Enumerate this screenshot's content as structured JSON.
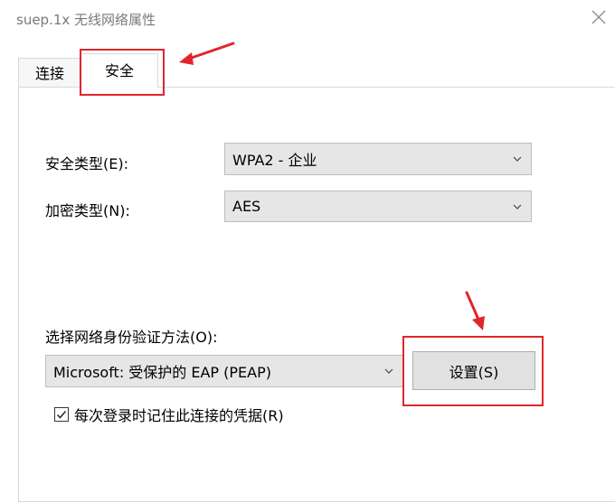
{
  "window": {
    "title": "suep.1x 无线网络属性",
    "close_icon": "close-icon"
  },
  "tabs": [
    {
      "label": "连接",
      "active": false
    },
    {
      "label": "安全",
      "active": true
    }
  ],
  "security": {
    "security_type_label": "安全类型(E):",
    "security_type_value": "WPA2 - 企业",
    "encryption_type_label": "加密类型(N):",
    "encryption_type_value": "AES",
    "auth_method_label": "选择网络身份验证方法(O):",
    "auth_method_value": "Microsoft: 受保护的 EAP (PEAP)",
    "settings_button": "设置(S)",
    "remember_credentials_label": "每次登录时记住此连接的凭据(R)",
    "remember_credentials_checked": true
  },
  "annotations": {
    "color": "#e0262b",
    "items": [
      "highlight-box-security-tab",
      "arrow-to-security-tab",
      "highlight-box-settings-button",
      "arrow-to-settings-button"
    ]
  }
}
